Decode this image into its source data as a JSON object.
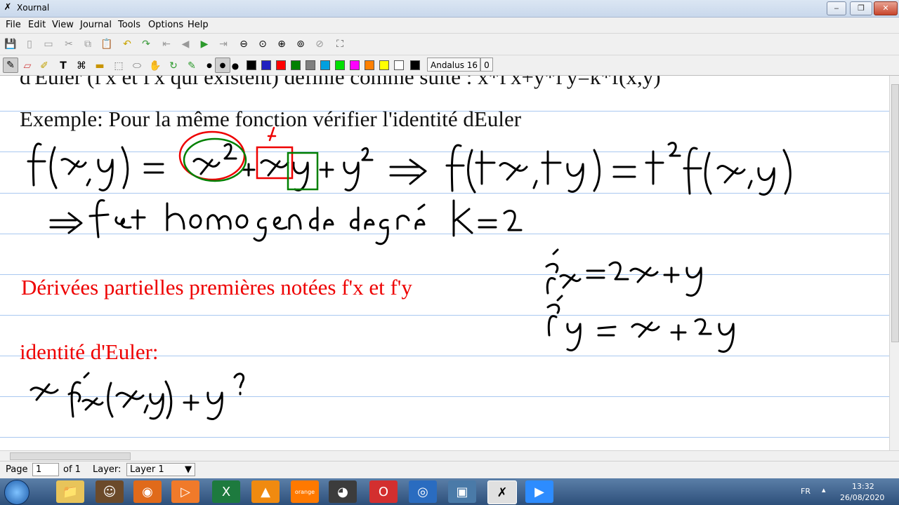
{
  "window": {
    "title": "Xournal",
    "app_icon": "xournal-x-icon"
  },
  "menu": [
    "File",
    "Edit",
    "View",
    "Journal",
    "Tools",
    "Options",
    "Help"
  ],
  "toolbar_font": {
    "name": "Andalus 16",
    "size_field": "0"
  },
  "colors": [
    "#000000",
    "#2020c0",
    "#ff0000",
    "#008000",
    "#808080",
    "#00a0e0",
    "#00e000",
    "#ff00ff",
    "#ff8000",
    "#ffff00",
    "#ffffff",
    "#000000"
  ],
  "document": {
    "line_top_cut": "d'Euler (f'x et f'x qui existent) définie comme suite : x*f'x+y*f'y=k*f(x,y)",
    "example": "Exemple: Pour la même fonction vérifier l'identité dEuler",
    "derivees": "Dérivées partielles premières notées f'x et f'y",
    "identite": "identité d'Euler:"
  },
  "status": {
    "page_label": "Page",
    "page_value": "1",
    "of_label": "of 1",
    "layer_label": "Layer:",
    "layer_value": "Layer 1"
  },
  "taskbar": {
    "lang": "FR",
    "time": "13:32",
    "date": "26/08/2020"
  }
}
